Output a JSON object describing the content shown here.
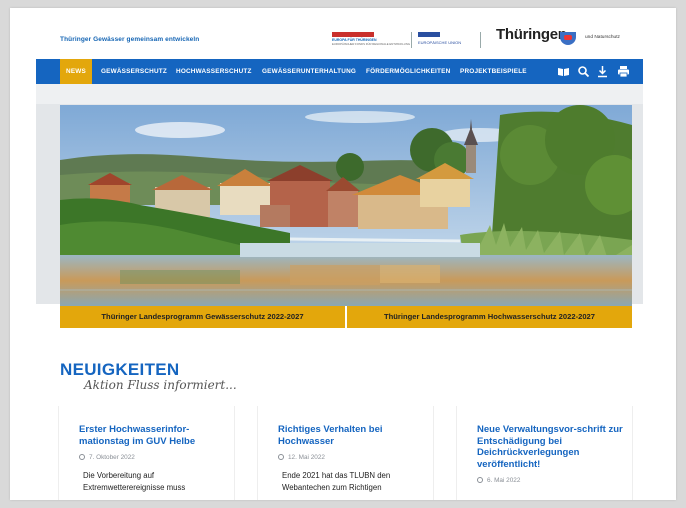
{
  "header": {
    "tagline": "Thüringer Gewässer gemeinsam entwickeln",
    "efre_logo_title": "EUROPA FÜR THÜRINGEN",
    "efre_logo_sub": "EUROPÄISCHER FONDS FÜR REGIONALE ENTWICKLUNG",
    "eu_logo_text": "EUROPÄISCHE UNION",
    "thueringen_logo": "Thüringen",
    "ministry_text": "und Naturschutz"
  },
  "nav": {
    "items": [
      {
        "label": "NEWS",
        "active": true
      },
      {
        "label": "GEWÄSSERSCHUTZ"
      },
      {
        "label": "HOCHWASSERSCHUTZ"
      },
      {
        "label": "GEWÄSSERUNTERHALTUNG"
      },
      {
        "label": "FÖRDERMÖGLICHKEITEN"
      },
      {
        "label": "PROJEKTBEISPIELE"
      }
    ],
    "icons": [
      "book-icon",
      "search-icon",
      "download-icon",
      "print-icon"
    ]
  },
  "hero": {
    "buttons": [
      "Thüringer Landesprogramm Gewässerschutz 2022-2027",
      "Thüringer Landesprogramm Hochwasserschutz 2022-2027"
    ]
  },
  "news": {
    "title": "NEUIGKEITEN",
    "subtitle": "Aktion Fluss informiert...",
    "cards": [
      {
        "title": "Erster Hochwasserinfor-mationstag im GUV Helbe",
        "date": "7. Oktober 2022",
        "text": "Die Vorbereitung auf Extremwetterereignisse muss"
      },
      {
        "title": "Richtiges Verhalten bei Hochwasser",
        "date": "12. Mai 2022",
        "text": "Ende 2021 hat das TLUBN den Webantechen zum Richtigen"
      },
      {
        "title": "Neue Verwaltungsvor-schrift zur Entschädigung bei Deichrückverlegungen veröffentlicht!",
        "date": "6. Mai 2022",
        "text": ""
      }
    ]
  },
  "colors": {
    "primary_blue": "#1565c0",
    "accent_yellow": "#e3a70c"
  }
}
